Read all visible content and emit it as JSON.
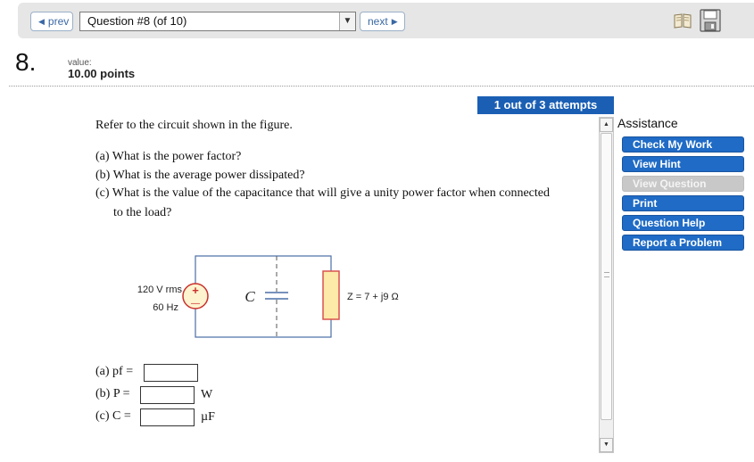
{
  "nav": {
    "prev_label": "prev",
    "next_label": "next",
    "question_select_value": "Question #8 (of 10)"
  },
  "question": {
    "number": "8.",
    "value_label": "value:",
    "points": "10.00 points",
    "attempts": "1 out of 3 attempts",
    "intro": "Refer to the circuit shown in the figure.",
    "part_a": "(a) What is the power factor?",
    "part_b": "(b) What is the average power dissipated?",
    "part_c_line1": "(c) What is the value of the capacitance that will give a unity power factor when connected",
    "part_c_line2": "to the load?"
  },
  "circuit": {
    "source_voltage": "120 V rms",
    "source_freq": "60 Hz",
    "plus": "+",
    "minus": "—",
    "capacitor_label": "C",
    "load_label": "Z = 7 + j9 Ω"
  },
  "answers": {
    "a_label": "(a) pf =",
    "b_label": "(b) P =",
    "b_unit": "W",
    "c_label": "(c) C =",
    "c_unit": "µF",
    "a_value": "",
    "b_value": "",
    "c_value": ""
  },
  "assistance": {
    "title": "Assistance",
    "buttons": [
      {
        "label": "Check My Work",
        "enabled": true
      },
      {
        "label": "View Hint",
        "enabled": true
      },
      {
        "label": "View Question",
        "enabled": false
      },
      {
        "label": "Print",
        "enabled": true
      },
      {
        "label": "Question Help",
        "enabled": true
      },
      {
        "label": "Report a Problem",
        "enabled": true
      }
    ]
  },
  "icons": {
    "book": "book-icon",
    "save": "save-icon",
    "prev": "triangle-left-icon",
    "next": "triangle-right-icon"
  },
  "colors": {
    "accent_blue": "#1f6bc6",
    "load_fill": "#fde9a8",
    "load_border": "#d9534f",
    "wire": "#4a6fa5"
  }
}
